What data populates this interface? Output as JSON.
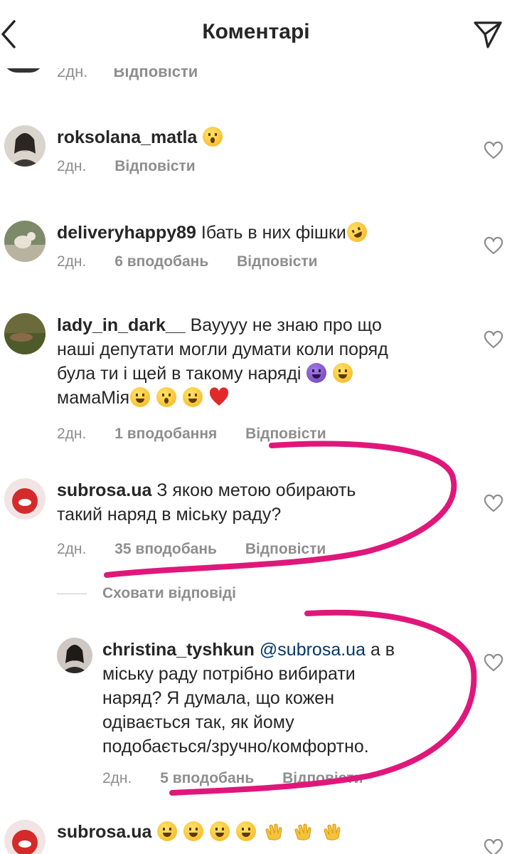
{
  "header": {
    "title": "Коментарі"
  },
  "top_partial": {
    "time": "2дн.",
    "reply_label": "Відповісти"
  },
  "comments": [
    {
      "username": "roksolana_matla",
      "text": "",
      "emoji": [
        "surprised"
      ],
      "time": "2дн.",
      "likes": "",
      "reply_label": "Відповісти"
    },
    {
      "username": "deliveryhappy89",
      "text": "Ібать в них фішки",
      "emoji": [
        "rofl"
      ],
      "time": "2дн.",
      "likes": "6 вподобань",
      "reply_label": "Відповісти"
    },
    {
      "username": "lady_in_dark__",
      "text_line1": "Вауууу не знаю про що",
      "text_line2": "наші депутати могли думати коли поряд",
      "text_line3": "була ти і щей в такому наряді",
      "text_line4": "мамаМія",
      "emoji": [
        "smiling-imp",
        "sweat-smile",
        "sweat-smile",
        "kissing-heart",
        "smiling-hearts",
        "red-heart"
      ],
      "time": "2дн.",
      "likes": "1 вподобання",
      "reply_label": "Відповісти"
    },
    {
      "username": "subrosa.ua",
      "text_line1": "З якою метою обирають",
      "text_line2": "такий наряд в міську раду?",
      "time": "2дн.",
      "likes": "35 вподобань",
      "reply_label": "Відповісти"
    }
  ],
  "hide_replies_label": "Сховати відповіді",
  "reply": {
    "username": "christina_tyshkun",
    "mention": "@subrosa.ua",
    "text_line1": "а в",
    "text_line2": "міську раду потрібно вибирати",
    "text_line3": "наряд? Я думала, що кожен",
    "text_line4": "одівається так, як йому",
    "text_line5": "подобається/зручно/комфортно.",
    "time": "2дн.",
    "likes": "5 вподобань",
    "reply_label": "Відповісти"
  },
  "last_comment": {
    "username": "subrosa.ua",
    "emoji": [
      "joy",
      "joy",
      "joy",
      "joy",
      "clap",
      "clap",
      "clap"
    ]
  },
  "colors": {
    "text": "#262626",
    "meta": "#8e8e8e",
    "mention": "#00376b",
    "annotation": "#e0177a"
  }
}
